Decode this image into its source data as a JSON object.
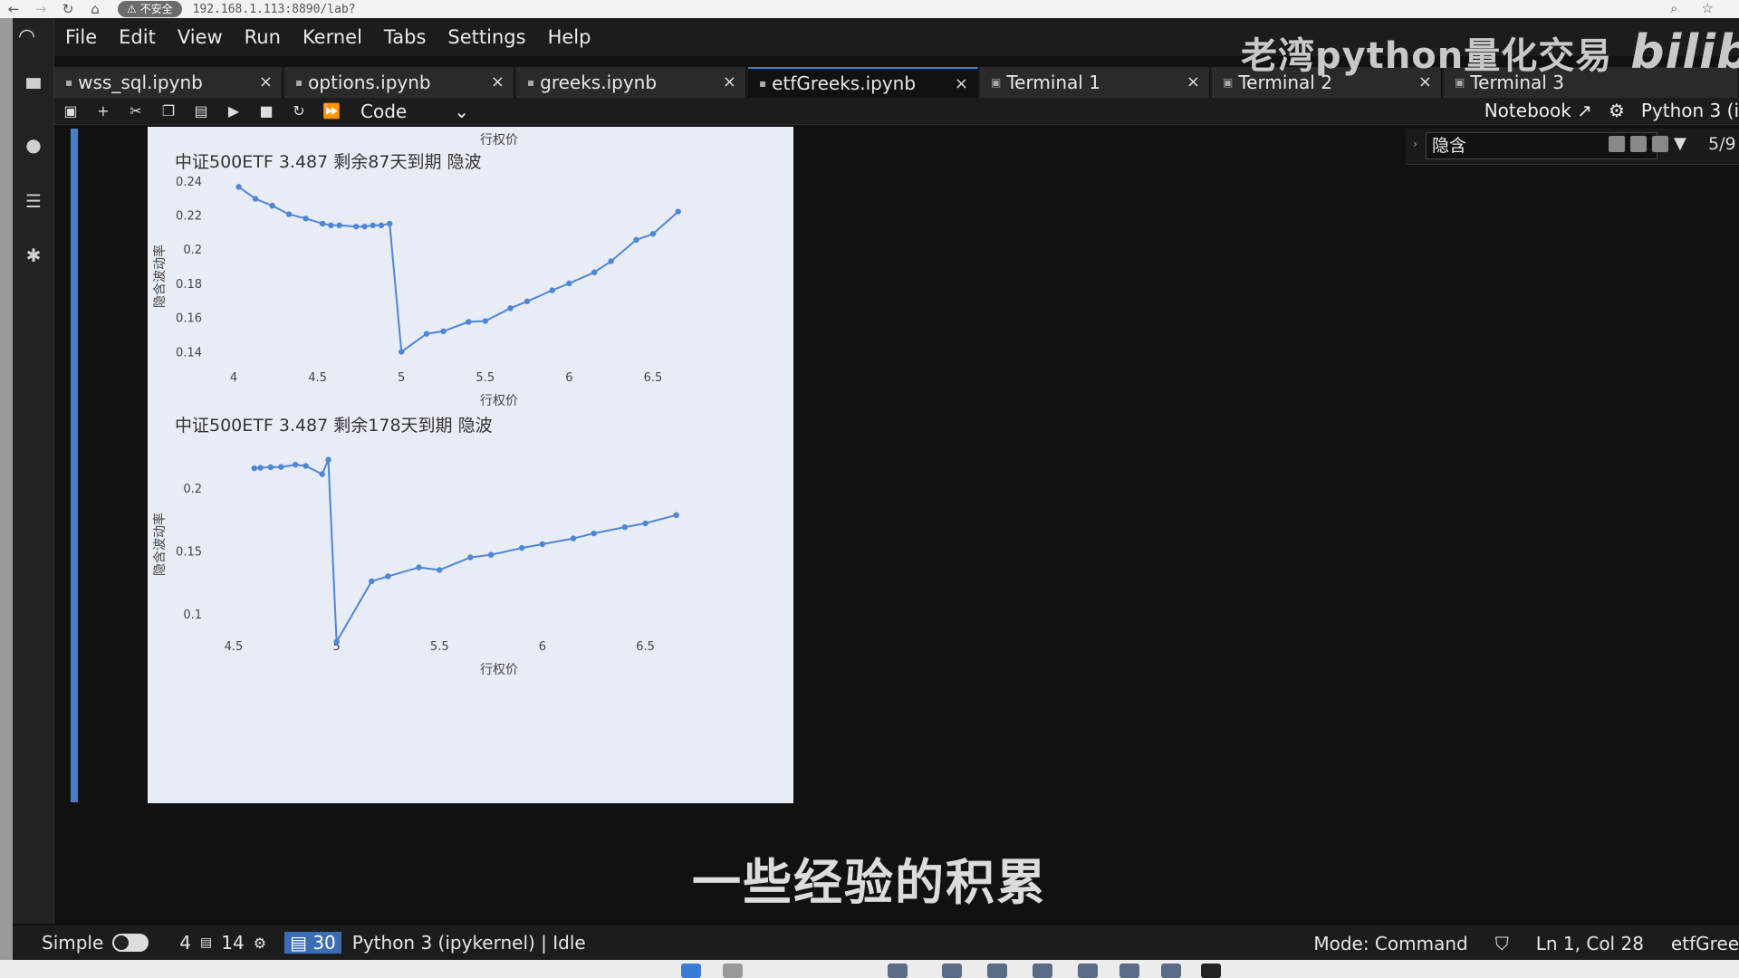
{
  "browser": {
    "security_badge": "⚠ 不安全",
    "url": "192.168.1.113:8890/lab?"
  },
  "menu": [
    "File",
    "Edit",
    "View",
    "Run",
    "Kernel",
    "Tabs",
    "Settings",
    "Help"
  ],
  "watermark": {
    "text": "老湾python量化交易",
    "brand": "bilibili"
  },
  "tabs": [
    {
      "label": "wss_sql.ipynb"
    },
    {
      "label": "options.ipynb"
    },
    {
      "label": "greeks.ipynb"
    },
    {
      "label": "etfGreeks.ipynb",
      "active": true
    },
    {
      "label": "Terminal 1"
    },
    {
      "label": "Terminal 2"
    },
    {
      "label": "Terminal 3"
    }
  ],
  "toolbar": {
    "cell_type": "Code",
    "notebook_label": "Notebook",
    "kernel_label": "Python 3 (i"
  },
  "search": {
    "query": "隐含",
    "count": "5/9"
  },
  "subtitle": "一些经验的积累",
  "status": {
    "mode_label": "Simple",
    "num1": "4",
    "num2": "14",
    "badge": "30",
    "kernel_status": "Python 3 (ipykernel) | Idle",
    "mode": "Mode: Command",
    "position": "Ln 1, Col 28",
    "file": "etfGree"
  },
  "top_axis_label": "行权价",
  "colors": {
    "accent": "#4a7dc4",
    "line": "#4f86d6",
    "plot_bg": "#e8ecf4"
  },
  "chart_data": [
    {
      "type": "line",
      "title": "中证500ETF 3.487 剩余87天到期 隐波",
      "xlabel": "行权价",
      "ylabel": "隐含波动率",
      "xticks": [
        "4",
        "4.5",
        "5",
        "5.5",
        "6",
        "6.5"
      ],
      "xtick_values": [
        4,
        4.5,
        5,
        5.5,
        6,
        6.5
      ],
      "yticks": [
        "0.14",
        "0.16",
        "0.18",
        "0.2",
        "0.22",
        "0.24"
      ],
      "ytick_values": [
        0.14,
        0.16,
        0.18,
        0.2,
        0.22,
        0.24
      ],
      "xlim": [
        4,
        6.7
      ],
      "ylim": [
        0.136,
        0.242
      ],
      "x": [
        4.03,
        4.13,
        4.23,
        4.33,
        4.43,
        4.53,
        4.58,
        4.63,
        4.73,
        4.78,
        4.83,
        4.88,
        4.93,
        5.0,
        5.15,
        5.25,
        5.4,
        5.5,
        5.65,
        5.75,
        5.9,
        6.0,
        6.15,
        6.25,
        6.4,
        6.5,
        6.65
      ],
      "y": [
        0.2365,
        0.2295,
        0.2255,
        0.2205,
        0.218,
        0.215,
        0.214,
        0.214,
        0.2133,
        0.2133,
        0.214,
        0.214,
        0.215,
        0.14,
        0.1505,
        0.152,
        0.1575,
        0.158,
        0.1655,
        0.1695,
        0.176,
        0.18,
        0.1865,
        0.193,
        0.2055,
        0.209,
        0.222
      ]
    },
    {
      "type": "line",
      "title": "中证500ETF 3.487 剩余178天到期 隐波",
      "xlabel": "行权价",
      "ylabel": "隐含波动率",
      "xticks": [
        "4.5",
        "5",
        "5.5",
        "6",
        "6.5"
      ],
      "xtick_values": [
        4.5,
        5,
        5.5,
        6,
        6.5
      ],
      "yticks": [
        "0.1",
        "0.15",
        "0.2"
      ],
      "ytick_values": [
        0.1,
        0.15,
        0.2
      ],
      "xlim": [
        4.5,
        6.7
      ],
      "ylim": [
        0.08,
        0.238
      ],
      "x": [
        4.6,
        4.63,
        4.68,
        4.73,
        4.8,
        4.85,
        4.93,
        4.96,
        5.0,
        5.17,
        5.25,
        5.4,
        5.5,
        5.65,
        5.75,
        5.9,
        6.0,
        6.15,
        6.25,
        6.4,
        6.5,
        6.65
      ],
      "y": [
        0.2157,
        0.216,
        0.2165,
        0.2167,
        0.2185,
        0.2175,
        0.211,
        0.2225,
        0.078,
        0.126,
        0.13,
        0.137,
        0.135,
        0.145,
        0.147,
        0.1525,
        0.1555,
        0.16,
        0.164,
        0.169,
        0.172,
        0.1785
      ]
    }
  ]
}
